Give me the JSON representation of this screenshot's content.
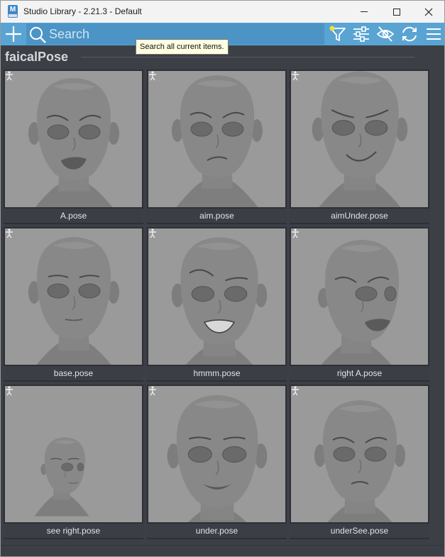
{
  "window": {
    "title": "Studio Library - 2.21.3 - Default",
    "app_icon_letter": "M"
  },
  "toolbar": {
    "search_placeholder": "Search",
    "tooltip": "Search all current items.",
    "icons": [
      "plus-icon",
      "search-icon",
      "filter-icon",
      "sliders-icon",
      "eye-slash-icon",
      "sync-icon",
      "menu-icon"
    ],
    "accent_color": "#5aa4d4",
    "filter_dot_color": "#e8e43a"
  },
  "group": {
    "title": "faicalPose"
  },
  "items": [
    {
      "label": "A.pose",
      "expression": "open-smile"
    },
    {
      "label": "aim.pose",
      "expression": "frown"
    },
    {
      "label": "aimUnder.pose",
      "expression": "smirk"
    },
    {
      "label": "base.pose",
      "expression": "neutral"
    },
    {
      "label": "hmmm.pose",
      "expression": "grit"
    },
    {
      "label": "right A.pose",
      "expression": "turn-right"
    },
    {
      "label": "see right.pose",
      "expression": "far-right"
    },
    {
      "label": "under.pose",
      "expression": "low-smile"
    },
    {
      "label": "underSee.pose",
      "expression": "pout"
    }
  ]
}
